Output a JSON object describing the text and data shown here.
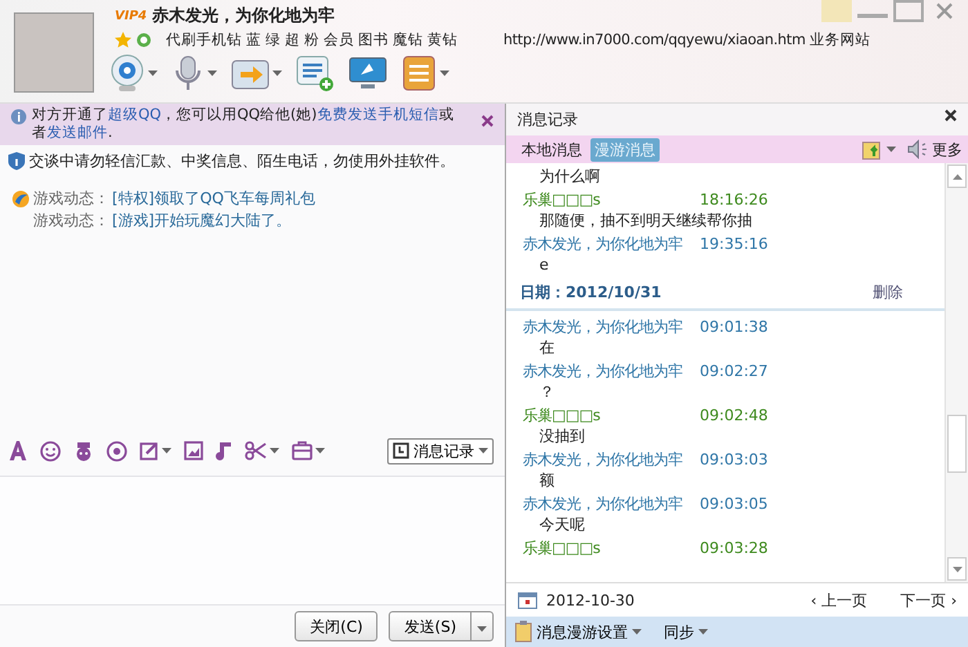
{
  "header": {
    "nickname": "赤木发光，为你化地为牢",
    "vip": "VIP4",
    "links": [
      "代刷手机钻",
      "蓝",
      "绿",
      "超",
      "粉",
      "会员",
      "图书",
      "魔钻",
      "黄钻"
    ],
    "url": "http://www.in7000.com/qqyewu/xiaoan.htm",
    "url_label": "业务网站"
  },
  "notice": {
    "segments": [
      {
        "text": "对方开通了",
        "link": false
      },
      {
        "text": "超级QQ",
        "link": true
      },
      {
        "text": "，您可以用QQ给他(她)",
        "link": false
      },
      {
        "text": "免费发送手机短信",
        "link": true
      },
      {
        "text": "或者",
        "link": false
      },
      {
        "text": "发送邮件",
        "link": true
      },
      {
        "text": ".",
        "link": false
      }
    ]
  },
  "security_notice": "交谈中请勿轻信汇款、中奖信息、陌生电话，勿使用外挂软件。",
  "game_feed": [
    {
      "label": "游戏动态：",
      "text": "[特权]领取了QQ飞车每周礼包"
    },
    {
      "label": "游戏动态：",
      "text": "[游戏]开始玩魔幻大陆了。"
    }
  ],
  "history_button": "消息记录",
  "buttons": {
    "close": "关闭(C)",
    "send": "发送(S)"
  },
  "history": {
    "title": "消息记录",
    "tabs": [
      {
        "label": "本地消息",
        "selected": false
      },
      {
        "label": "漫游消息",
        "selected": true
      }
    ],
    "more": "更多",
    "entries": [
      {
        "kind": "text",
        "text": "为什么啊"
      },
      {
        "kind": "message",
        "sender": "乐巢□□□s",
        "mine": false,
        "time": "18:16:26",
        "text": "那随便，抽不到明天继续帮你抽"
      },
      {
        "kind": "message",
        "sender": "赤木发光，为你化地为牢",
        "mine": true,
        "time": "19:35:16",
        "text": "e"
      },
      {
        "kind": "date",
        "label": "日期：2012/10/31",
        "action": "删除"
      },
      {
        "kind": "message",
        "sender": "赤木发光，为你化地为牢",
        "mine": true,
        "time": "09:01:38",
        "text": "在"
      },
      {
        "kind": "message",
        "sender": "赤木发光，为你化地为牢",
        "mine": true,
        "time": "09:02:27",
        "text": "？"
      },
      {
        "kind": "message",
        "sender": "乐巢□□□s",
        "mine": false,
        "time": "09:02:48",
        "text": "没抽到"
      },
      {
        "kind": "message",
        "sender": "赤木发光，为你化地为牢",
        "mine": true,
        "time": "09:03:03",
        "text": "额"
      },
      {
        "kind": "message",
        "sender": "赤木发光，为你化地为牢",
        "mine": true,
        "time": "09:03:05",
        "text": "今天呢"
      },
      {
        "kind": "message",
        "sender": "乐巢□□□s",
        "mine": false,
        "time": "09:03:28"
      }
    ],
    "date": "2012-10-30",
    "prev": "‹ 上一页",
    "next": "下一页 ›",
    "roaming_settings": "消息漫游设置",
    "sync": "同步"
  }
}
